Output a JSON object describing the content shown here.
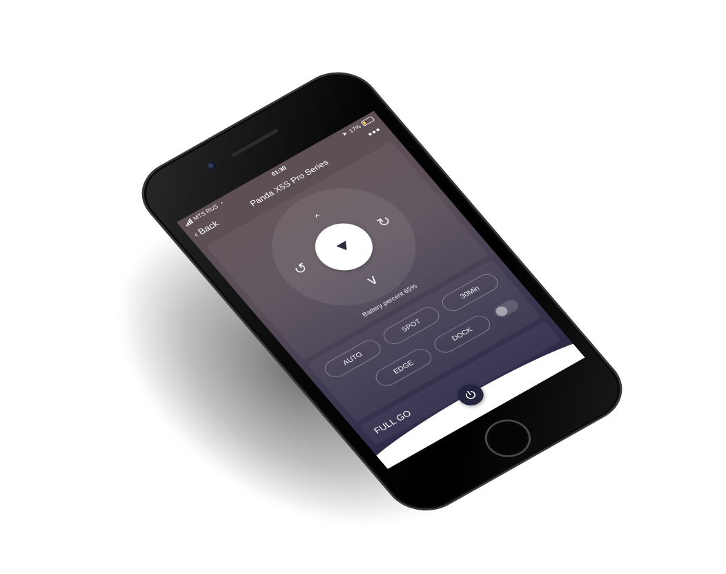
{
  "status_bar": {
    "carrier": "MTS RUS",
    "time": "01:30",
    "battery_percent": "17%"
  },
  "nav": {
    "back_label": "Back",
    "title": "Panda X5S Pro Series",
    "more_label": "•••"
  },
  "control": {
    "battery_text": "Battery percent 65%",
    "icons": {
      "up": "chevron-up-icon",
      "down": "chevron-down-icon",
      "rotate_left": "rotate-left-icon",
      "rotate_right": "rotate-right-icon",
      "start": "play-icon"
    }
  },
  "modes": {
    "auto": "AUTO",
    "spot": "SPOT",
    "timer": "30Min",
    "edge": "EDGE",
    "dock": "DOCK",
    "toggle_on": false
  },
  "fullgo": {
    "label": "FULL GO"
  },
  "colors": {
    "screen_top": "#5e4f55",
    "screen_bottom": "#2a2847",
    "power_button": "#25243f"
  }
}
